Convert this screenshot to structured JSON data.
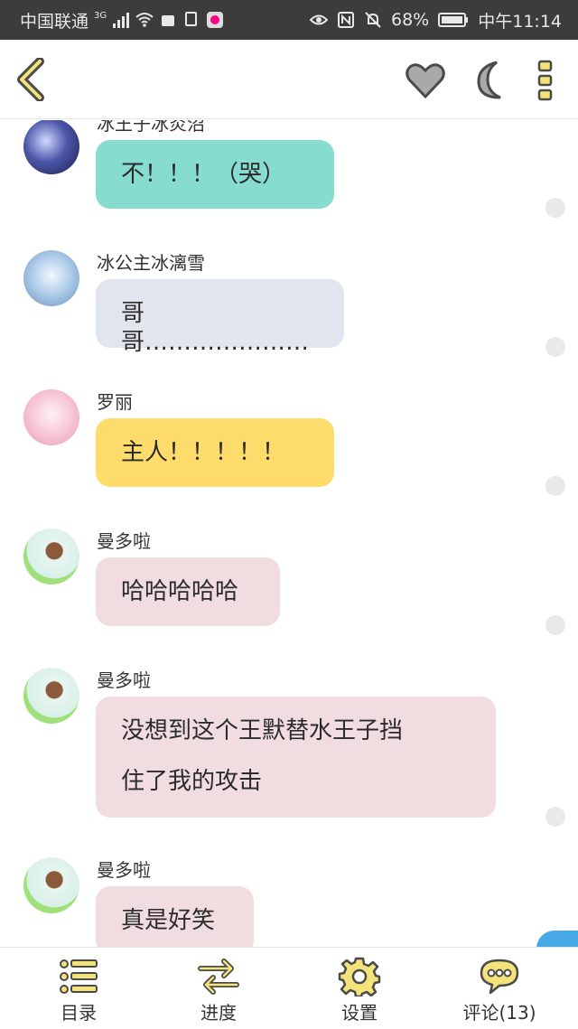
{
  "status_bar": {
    "carrier": "中国联通",
    "network": "3G",
    "battery": "68%",
    "time": "中午11:14"
  },
  "header": {
    "back_icon": "chevron-left-icon",
    "favorite_icon": "heart-icon",
    "night_mode_icon": "moon-icon",
    "more_icon": "vertical-dots-icon"
  },
  "messages": [
    {
      "name": "冰王子冰炎沼",
      "text": "不！！！（哭）",
      "bubble_color": "#87dcd0"
    },
    {
      "name": "冰公主冰漓雪",
      "text": "哥哥…………………",
      "bubble_color": "#e1e6ee"
    },
    {
      "name": "罗丽",
      "text": "主人！！！！！",
      "bubble_color": "#fedc6b"
    },
    {
      "name": "曼多啦",
      "text": "哈哈哈哈哈",
      "bubble_color": "#f1dde0"
    },
    {
      "name": "曼多啦",
      "text_line1": "没想到这个王默替水王子挡",
      "text_line2": "住了我的攻击",
      "bubble_color": "#f1dde0"
    },
    {
      "name": "曼多啦",
      "text": "真是好笑",
      "bubble_color": "#f1dde0"
    }
  ],
  "tabs": [
    {
      "label": "目录",
      "icon": "list-icon"
    },
    {
      "label": "进度",
      "icon": "swap-arrows-icon"
    },
    {
      "label": "设置",
      "icon": "gear-icon"
    },
    {
      "label": "评论(13)",
      "icon": "speech-bubble-icon"
    }
  ],
  "colors": {
    "accent_yellow": "#f4e27a",
    "icon_outline": "#4a4a4a",
    "status_bar_bg": "#3c3c3c"
  }
}
